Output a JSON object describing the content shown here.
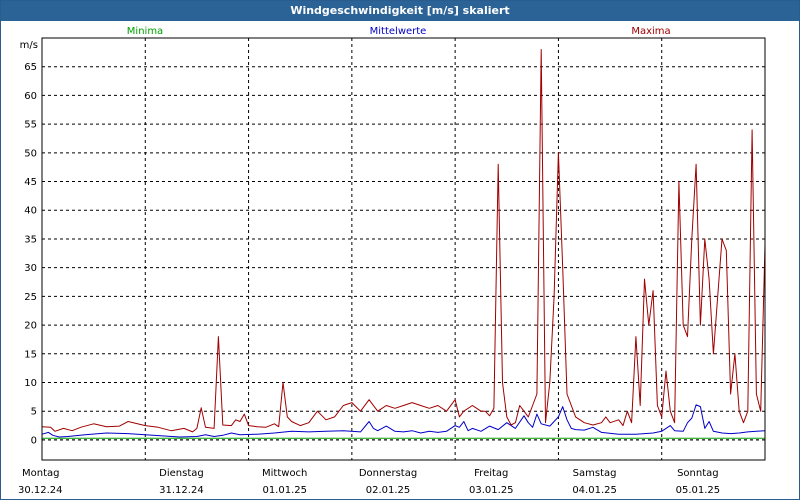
{
  "chart_data": {
    "type": "line",
    "title": "Windgeschwindigkeit [m/s] skaliert",
    "ylabel": "m/s",
    "ylim": [
      -3.5,
      70
    ],
    "yticks": [
      0,
      5,
      10,
      15,
      20,
      25,
      30,
      35,
      40,
      45,
      50,
      55,
      60,
      65
    ],
    "xlim": [
      0,
      168
    ],
    "grid": true,
    "day_labels": [
      {
        "day": "Montag",
        "date": "30.12.24"
      },
      {
        "day": "Dienstag",
        "date": "31.12.24"
      },
      {
        "day": "Mittwoch",
        "date": "01.01.25"
      },
      {
        "day": "Donnerstag",
        "date": "02.01.25"
      },
      {
        "day": "Freitag",
        "date": "03.01.25"
      },
      {
        "day": "Samstag",
        "date": "04.01.25"
      },
      {
        "day": "Sonntag",
        "date": "05.01.25"
      }
    ],
    "series": [
      {
        "name": "Minima",
        "color": "#00a000",
        "points": [
          [
            0,
            0.3
          ],
          [
            24,
            0.3
          ],
          [
            48,
            0.3
          ],
          [
            72,
            0.3
          ],
          [
            96,
            0.3
          ],
          [
            120,
            0.3
          ],
          [
            144,
            0.3
          ],
          [
            168,
            0.3
          ]
        ]
      },
      {
        "name": "Mittelwerte",
        "color": "#0000c8",
        "points": [
          [
            0,
            1
          ],
          [
            1.5,
            1.3
          ],
          [
            2.5,
            0.8
          ],
          [
            4,
            0.5
          ],
          [
            6,
            0.6
          ],
          [
            10,
            0.9
          ],
          [
            15,
            1.2
          ],
          [
            20,
            1.1
          ],
          [
            24,
            0.9
          ],
          [
            28,
            0.7
          ],
          [
            32,
            0.5
          ],
          [
            36,
            0.6
          ],
          [
            38,
            0.9
          ],
          [
            40,
            0.6
          ],
          [
            42,
            0.8
          ],
          [
            44,
            1.2
          ],
          [
            46,
            0.9
          ],
          [
            50,
            1
          ],
          [
            54,
            1.2
          ],
          [
            58,
            1.5
          ],
          [
            62,
            1.4
          ],
          [
            66,
            1.5
          ],
          [
            70,
            1.6
          ],
          [
            74,
            1.4
          ],
          [
            76,
            3.2
          ],
          [
            77,
            2
          ],
          [
            78,
            1.6
          ],
          [
            80,
            2.4
          ],
          [
            82,
            1.5
          ],
          [
            84,
            1.4
          ],
          [
            86,
            1.6
          ],
          [
            88,
            1.2
          ],
          [
            90,
            1.5
          ],
          [
            92,
            1.3
          ],
          [
            94,
            1.5
          ],
          [
            96,
            2.5
          ],
          [
            97,
            2.2
          ],
          [
            98,
            3.2
          ],
          [
            99,
            1.6
          ],
          [
            100,
            2
          ],
          [
            102,
            1.5
          ],
          [
            104,
            2.4
          ],
          [
            106,
            1.8
          ],
          [
            108,
            3
          ],
          [
            110,
            2
          ],
          [
            112,
            4.2
          ],
          [
            113,
            3
          ],
          [
            114,
            2.2
          ],
          [
            115,
            4.5
          ],
          [
            116,
            2.8
          ],
          [
            118,
            2.4
          ],
          [
            120,
            4
          ],
          [
            121,
            5.8
          ],
          [
            122,
            3.5
          ],
          [
            123,
            2
          ],
          [
            124,
            1.8
          ],
          [
            126,
            1.7
          ],
          [
            128,
            2.2
          ],
          [
            130,
            1.3
          ],
          [
            134,
            1
          ],
          [
            138,
            1
          ],
          [
            142,
            1.2
          ],
          [
            144,
            1.5
          ],
          [
            146,
            2.5
          ],
          [
            147,
            1.6
          ],
          [
            149,
            1.5
          ],
          [
            150,
            3
          ],
          [
            151,
            3.8
          ],
          [
            152,
            6.1
          ],
          [
            153,
            5.8
          ],
          [
            154,
            2
          ],
          [
            155,
            3.2
          ],
          [
            156,
            1.5
          ],
          [
            158,
            1.2
          ],
          [
            160,
            1.1
          ],
          [
            162,
            1.2
          ],
          [
            164,
            1.4
          ],
          [
            166,
            1.5
          ],
          [
            168,
            1.6
          ]
        ]
      },
      {
        "name": "Maxima",
        "color": "#a00000",
        "points": [
          [
            0,
            2.3
          ],
          [
            2,
            2.2
          ],
          [
            3,
            1.5
          ],
          [
            5,
            2
          ],
          [
            7,
            1.6
          ],
          [
            9,
            2.2
          ],
          [
            12,
            2.8
          ],
          [
            15,
            2.3
          ],
          [
            18,
            2.4
          ],
          [
            20,
            3.2
          ],
          [
            24,
            2.5
          ],
          [
            27,
            2.2
          ],
          [
            30,
            1.6
          ],
          [
            33,
            2
          ],
          [
            35,
            1.4
          ],
          [
            36,
            2
          ],
          [
            37,
            5.6
          ],
          [
            38,
            2.2
          ],
          [
            40,
            2
          ],
          [
            41,
            18
          ],
          [
            42,
            2.6
          ],
          [
            44,
            2.5
          ],
          [
            45,
            3.5
          ],
          [
            46,
            3.2
          ],
          [
            47,
            4.5
          ],
          [
            48,
            2.5
          ],
          [
            50,
            2.3
          ],
          [
            52,
            2.2
          ],
          [
            54,
            2.8
          ],
          [
            55,
            2.3
          ],
          [
            56,
            10
          ],
          [
            57,
            4
          ],
          [
            58,
            3.2
          ],
          [
            60,
            2.5
          ],
          [
            62,
            3
          ],
          [
            64,
            5
          ],
          [
            66,
            3.5
          ],
          [
            68,
            4
          ],
          [
            70,
            6
          ],
          [
            72,
            6.5
          ],
          [
            74,
            5
          ],
          [
            76,
            7
          ],
          [
            78,
            5
          ],
          [
            80,
            6
          ],
          [
            82,
            5.5
          ],
          [
            84,
            6
          ],
          [
            86,
            6.5
          ],
          [
            88,
            6
          ],
          [
            90,
            5.5
          ],
          [
            92,
            6
          ],
          [
            94,
            5
          ],
          [
            96,
            7
          ],
          [
            97,
            4
          ],
          [
            98,
            5
          ],
          [
            100,
            6
          ],
          [
            101,
            5.5
          ],
          [
            102,
            5
          ],
          [
            103,
            5
          ],
          [
            104,
            4.2
          ],
          [
            105,
            5.5
          ],
          [
            106,
            48
          ],
          [
            107,
            10
          ],
          [
            108,
            4
          ],
          [
            109,
            2.6
          ],
          [
            110,
            3
          ],
          [
            111,
            6
          ],
          [
            112,
            5
          ],
          [
            113,
            4
          ],
          [
            114,
            6
          ],
          [
            115,
            8
          ],
          [
            116,
            68
          ],
          [
            117,
            3
          ],
          [
            118,
            10
          ],
          [
            119,
            25
          ],
          [
            120,
            50
          ],
          [
            121,
            30
          ],
          [
            122,
            8
          ],
          [
            124,
            4
          ],
          [
            126,
            3
          ],
          [
            128,
            2.6
          ],
          [
            130,
            3
          ],
          [
            131,
            4
          ],
          [
            132,
            3
          ],
          [
            134,
            3.5
          ],
          [
            135,
            2.5
          ],
          [
            136,
            5
          ],
          [
            137,
            3
          ],
          [
            138,
            18
          ],
          [
            139,
            6
          ],
          [
            140,
            28
          ],
          [
            141,
            20
          ],
          [
            142,
            26
          ],
          [
            143,
            6
          ],
          [
            144,
            4
          ],
          [
            145,
            12
          ],
          [
            146,
            5
          ],
          [
            147,
            3
          ],
          [
            148,
            45
          ],
          [
            149,
            20
          ],
          [
            150,
            18
          ],
          [
            151,
            35
          ],
          [
            152,
            48
          ],
          [
            153,
            20
          ],
          [
            154,
            35
          ],
          [
            155,
            28
          ],
          [
            156,
            15
          ],
          [
            157,
            25
          ],
          [
            158,
            35
          ],
          [
            159,
            33
          ],
          [
            160,
            8
          ],
          [
            161,
            15
          ],
          [
            162,
            5
          ],
          [
            163,
            3
          ],
          [
            164,
            5
          ],
          [
            165,
            54
          ],
          [
            166,
            8
          ],
          [
            167,
            5
          ],
          [
            168,
            34
          ]
        ]
      }
    ]
  }
}
